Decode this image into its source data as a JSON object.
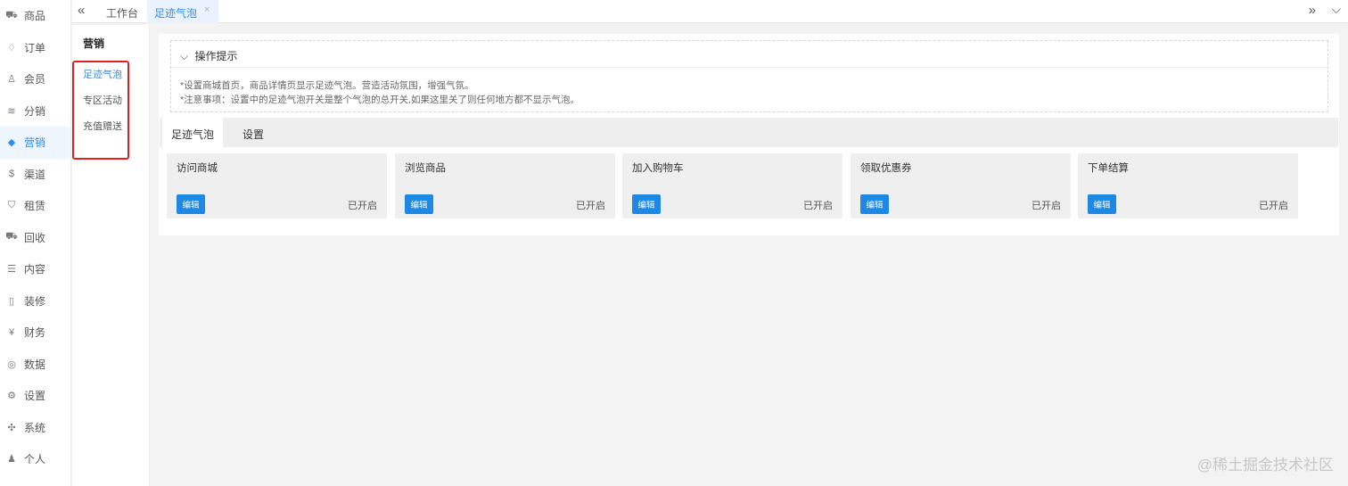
{
  "nav": [
    {
      "label": "商品",
      "icon": "cart-icon",
      "glyph": "⛟"
    },
    {
      "label": "订单",
      "icon": "bell-icon",
      "glyph": "♢"
    },
    {
      "label": "会员",
      "icon": "user-icon",
      "glyph": "♙"
    },
    {
      "label": "分销",
      "icon": "layers-icon",
      "glyph": "≋"
    },
    {
      "label": "营销",
      "icon": "diamond-icon",
      "glyph": "◆",
      "active": true
    },
    {
      "label": "渠道",
      "icon": "dollar-icon",
      "glyph": "$"
    },
    {
      "label": "租赁",
      "icon": "shield-icon",
      "glyph": "⛉"
    },
    {
      "label": "回收",
      "icon": "cart-icon",
      "glyph": "⛟"
    },
    {
      "label": "内容",
      "icon": "book-icon",
      "glyph": "☰"
    },
    {
      "label": "装修",
      "icon": "page-icon",
      "glyph": "▯"
    },
    {
      "label": "财务",
      "icon": "yen-icon",
      "glyph": "¥"
    },
    {
      "label": "数据",
      "icon": "globe-icon",
      "glyph": "◎"
    },
    {
      "label": "设置",
      "icon": "gear-icon",
      "glyph": "⚙"
    },
    {
      "label": "系统",
      "icon": "cross-tools-icon",
      "glyph": "✣"
    },
    {
      "label": "个人",
      "icon": "person-icon",
      "glyph": "♟"
    }
  ],
  "subnav": {
    "title": "营销",
    "items": [
      "足迹气泡",
      "专区活动",
      "充值赠送"
    ]
  },
  "topbar": {
    "home_tab": "工作台",
    "active_tab": "足迹气泡",
    "close": "×"
  },
  "tips": {
    "title": "操作提示",
    "lines": [
      "*设置商城首页，商品详情页显示足迹气泡。营造活动氛围，增强气氛。",
      "*注意事项：设置中的足迹气泡开关是整个气泡的总开关,如果这里关了则任何地方都不显示气泡。"
    ]
  },
  "panel_tabs": [
    "足迹气泡",
    "设置"
  ],
  "cards": [
    {
      "title": "访问商城",
      "button": "编辑",
      "status": "已开启"
    },
    {
      "title": "浏览商品",
      "button": "编辑",
      "status": "已开启"
    },
    {
      "title": "加入购物车",
      "button": "编辑",
      "status": "已开启"
    },
    {
      "title": "领取优惠券",
      "button": "编辑",
      "status": "已开启"
    },
    {
      "title": "下单结算",
      "button": "编辑",
      "status": "已开启"
    }
  ],
  "watermark": "@稀土掘金技术社区",
  "colors": {
    "accent": "#2d8cf0",
    "button": "#1e88e5",
    "highlight_box": "#e02020"
  }
}
